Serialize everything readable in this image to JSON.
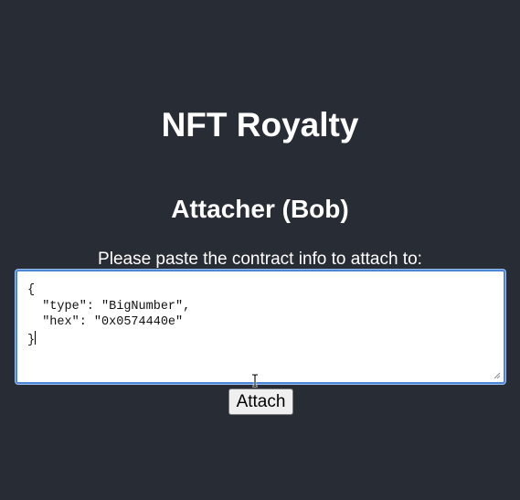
{
  "app": {
    "title": "NFT Royalty"
  },
  "attacher": {
    "heading": "Attacher (Bob)",
    "prompt": "Please paste the contract info to attach to:",
    "contract_info_lines": [
      "{",
      "  \"type\": \"BigNumber\",",
      "  \"hex\": \"0x0574440e\"",
      "}"
    ],
    "attach_button_label": "Attach"
  },
  "colors": {
    "background": "#282c34",
    "text": "#ffffff",
    "focus_border": "#4d86d6",
    "button_bg": "#efefef"
  },
  "icons": {
    "textarea_resize": "resize-grip-icon",
    "mouse_cursor": "text-ibeam-cursor-icon"
  }
}
